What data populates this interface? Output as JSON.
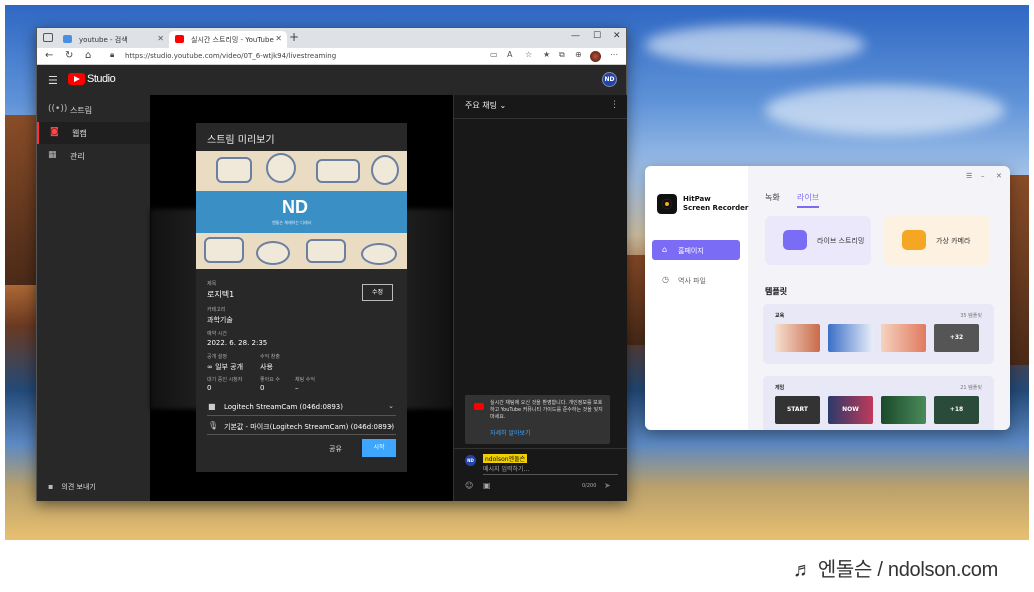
{
  "browser": {
    "tabs": [
      {
        "label": "youtube - 검색"
      },
      {
        "label": "실시간 스트리밍 - YouTube"
      }
    ],
    "new_tab": "+",
    "url": "https://studio.youtube.com/video/0T_6-wtjk94/livestreaming"
  },
  "studio": {
    "brand": "Studio",
    "avatar": "ND",
    "sidebar": [
      {
        "label": "스트림",
        "icon": "broadcast-icon"
      },
      {
        "label": "웹캠",
        "icon": "camera-icon"
      },
      {
        "label": "관리",
        "icon": "calendar-icon"
      }
    ],
    "feedback": "의견 보내기",
    "preview": {
      "title": "스트림 미리보기",
      "thumb_text": "ND",
      "thumb_sub": "엔돌슨 체재하는 디래서",
      "title_label": "제목",
      "title_value": "로지텍1",
      "edit_label": "수정",
      "category_label": "카테고리",
      "category_value": "과학기술",
      "schedule_label": "예약 시간",
      "schedule_value": "2022. 6. 28. 2:35",
      "privacy_label": "공개 설정",
      "privacy_value": "일부 공개",
      "monetize_label": "수익 창출",
      "monetize_value": "사용",
      "waiting_label": "대기 중인 시청자",
      "waiting_value": "0",
      "likes_label": "좋아요 수",
      "likes_value": "0",
      "chat_count_label": "채팅 수익",
      "chat_count_value": "–",
      "camera": "Logitech StreamCam (046d:0893)",
      "mic": "기본값 - 마이크(Logitech StreamCam) (046d:0893)",
      "share_label": "공유",
      "start_label": "시작"
    },
    "chat": {
      "header": "주요 채팅",
      "notice": "실시간 채팅에 오신 것을 환영합니다. 개인정보를 보호하고 YouTube 커뮤니티 가이드를 준수하는 것을 잊지 마세요.",
      "notice_link": "자세히 알아보기",
      "username": "ndolson엔돌슨",
      "placeholder": "메시지 입력하기...",
      "counter": "0/200",
      "avatar": "ND"
    }
  },
  "hitpaw": {
    "app_name": "HitPaw\nScreen Recorder",
    "nav": [
      {
        "label": "홈페이지"
      },
      {
        "label": "역사 파일"
      }
    ],
    "tabs": [
      "녹화",
      "라이브"
    ],
    "cards": [
      {
        "label": "라이브 스트리밍"
      },
      {
        "label": "가상 카메라"
      }
    ],
    "templates_title": "템플릿",
    "sections": [
      {
        "name": "교육",
        "count": "35 템플릿",
        "thumbs": [
          "",
          "",
          "",
          "+32"
        ]
      },
      {
        "name": "게임",
        "count": "21 템플릿",
        "thumbs": [
          "START",
          "NOW",
          "",
          "+18"
        ]
      }
    ]
  },
  "footer": {
    "brand": "♬ 엔돌슨 / ndolson.com"
  },
  "colors": {
    "youtube_red": "#ff0000",
    "studio_bg": "#282828",
    "start_button": "#3ea6ff",
    "hitpaw_accent": "#7b6cf6",
    "username_highlight": "#f0d000"
  }
}
